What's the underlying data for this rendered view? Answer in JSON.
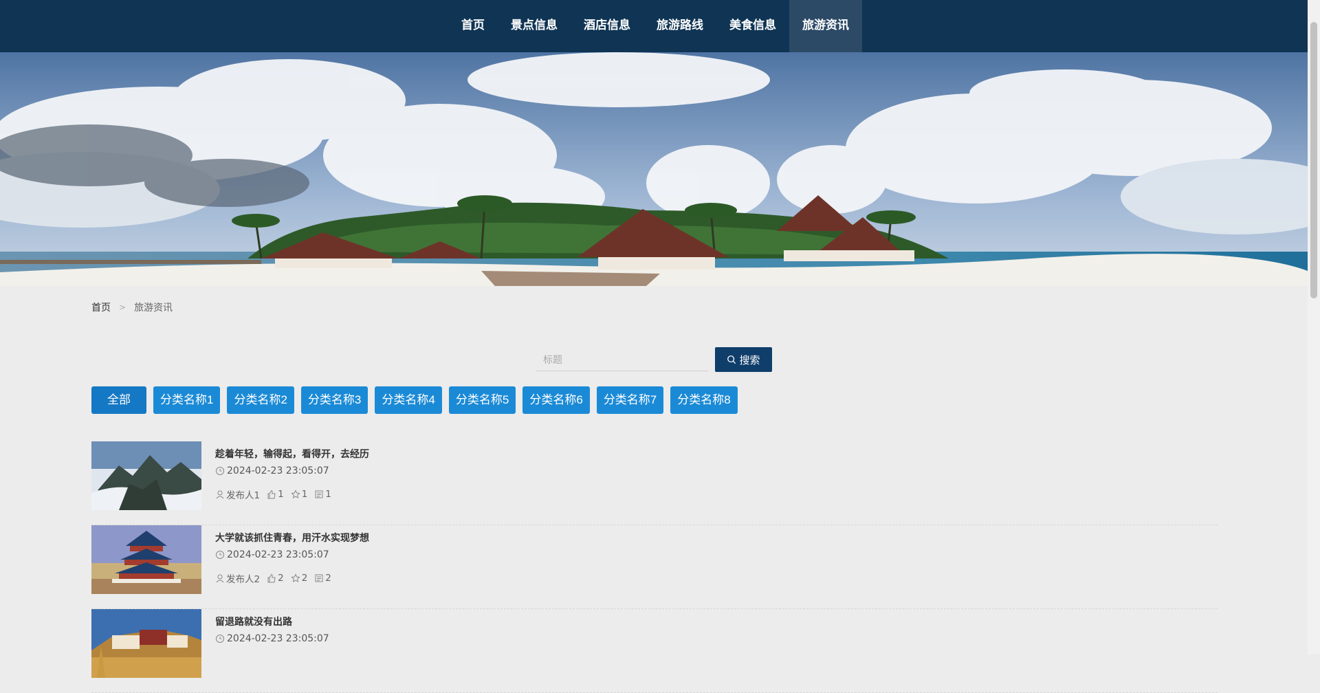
{
  "nav": {
    "items": [
      {
        "label": "首页"
      },
      {
        "label": "景点信息"
      },
      {
        "label": "酒店信息"
      },
      {
        "label": "旅游路线"
      },
      {
        "label": "美食信息"
      },
      {
        "label": "旅游资讯"
      }
    ],
    "active_index": 5
  },
  "breadcrumb": {
    "home": "首页",
    "separator": ">",
    "current": "旅游资讯"
  },
  "search": {
    "placeholder": "标题",
    "value": "",
    "button_label": "搜索"
  },
  "categories": [
    "全部",
    "分类名称1",
    "分类名称2",
    "分类名称3",
    "分类名称4",
    "分类名称5",
    "分类名称6",
    "分类名称7",
    "分类名称8"
  ],
  "news": [
    {
      "title": "趁着年轻，输得起，看得开，去经历",
      "time": "2024-02-23 23:05:07",
      "author": "发布人1",
      "likes": "1",
      "favorites": "1",
      "comments": "1",
      "image": "mountain-sea-of-clouds"
    },
    {
      "title": "大学就该抓住青春，用汗水实现梦想",
      "time": "2024-02-23 23:05:07",
      "author": "发布人2",
      "likes": "2",
      "favorites": "2",
      "comments": "2",
      "image": "temple-of-heaven"
    },
    {
      "title": "留退路就没有出路",
      "time": "2024-02-23 23:05:07",
      "author": "",
      "likes": "",
      "favorites": "",
      "comments": "",
      "image": "potala-palace"
    }
  ],
  "colors": {
    "nav_bg": "#0f3454",
    "nav_active": "#2c4a66",
    "search_button": "#0f3e6a",
    "category_button": "#1b8ad6",
    "page_bg": "#ececec"
  },
  "icons": [
    "search-icon",
    "clock-icon",
    "user-icon",
    "thumb-up-icon",
    "star-icon",
    "comment-icon"
  ]
}
